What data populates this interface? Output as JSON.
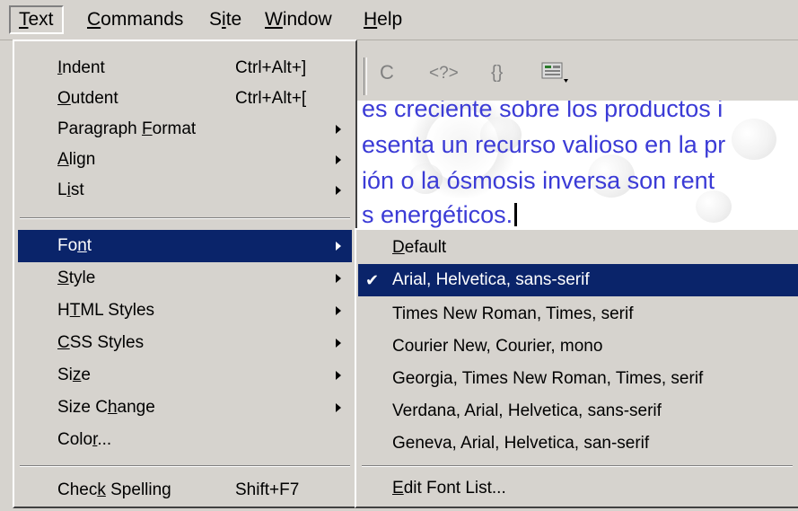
{
  "menubar": {
    "items": [
      {
        "label": "Text",
        "u": "T",
        "rest": "ext"
      },
      {
        "label": "Commands",
        "u": "C",
        "rest": "ommands"
      },
      {
        "label": "Site",
        "pre": "S",
        "u": "i",
        "rest": "te"
      },
      {
        "label": "Window",
        "u": "W",
        "rest": "indow"
      },
      {
        "label": "Help",
        "u": "H",
        "rest": "elp"
      }
    ]
  },
  "document": {
    "lines": [
      "es creciente sobre los productos i",
      "esenta un recurso valioso en la pr",
      "ión o la ósmosis inversa son rent",
      "s energéticos."
    ]
  },
  "toolbar": {
    "icons": [
      "refresh-icon",
      "php-tag-icon",
      "braces-icon",
      "options-icon"
    ],
    "refresh_glyph": "C",
    "php_glyph": "<?>",
    "braces_glyph": "{}"
  },
  "text_menu": {
    "indent": {
      "pre": "",
      "u": "I",
      "rest": "ndent",
      "shortcut": "Ctrl+Alt+]"
    },
    "outdent": {
      "pre": "",
      "u": "O",
      "rest": "utdent",
      "shortcut": "Ctrl+Alt+["
    },
    "paragraph_format": {
      "pre": "Paragraph ",
      "u": "F",
      "rest": "ormat"
    },
    "align": {
      "pre": "",
      "u": "A",
      "rest": "lign"
    },
    "list": {
      "pre": "L",
      "u": "i",
      "rest": "st"
    },
    "font": {
      "pre": "Fo",
      "u": "n",
      "rest": "t"
    },
    "style": {
      "pre": "",
      "u": "S",
      "rest": "tyle"
    },
    "html_styles": {
      "pre": "H",
      "u": "T",
      "rest": "ML Styles"
    },
    "css_styles": {
      "pre": "",
      "u": "C",
      "rest": "SS Styles"
    },
    "size": {
      "pre": "Si",
      "u": "z",
      "rest": "e"
    },
    "size_change": {
      "pre": "Size C",
      "u": "h",
      "rest": "ange"
    },
    "color": {
      "pre": "Colo",
      "u": "r",
      "rest": "..."
    },
    "check_spelling": {
      "pre": "Chec",
      "u": "k",
      "rest": " Spelling",
      "shortcut": "Shift+F7"
    }
  },
  "font_submenu": {
    "default": {
      "u": "D",
      "rest": "efault"
    },
    "items": [
      "Arial, Helvetica, sans-serif",
      "Times New Roman, Times, serif",
      "Courier New, Courier, mono",
      "Georgia, Times New Roman, Times, serif",
      "Verdana, Arial, Helvetica, sans-serif",
      "Geneva, Arial, Helvetica, san-serif"
    ],
    "edit": {
      "u": "E",
      "rest": "dit Font List..."
    },
    "checkmark": "✔"
  },
  "colors": {
    "menu_bg": "#d6d3ce",
    "highlight": "#0a246a",
    "doc_text": "#3b3bd6"
  }
}
